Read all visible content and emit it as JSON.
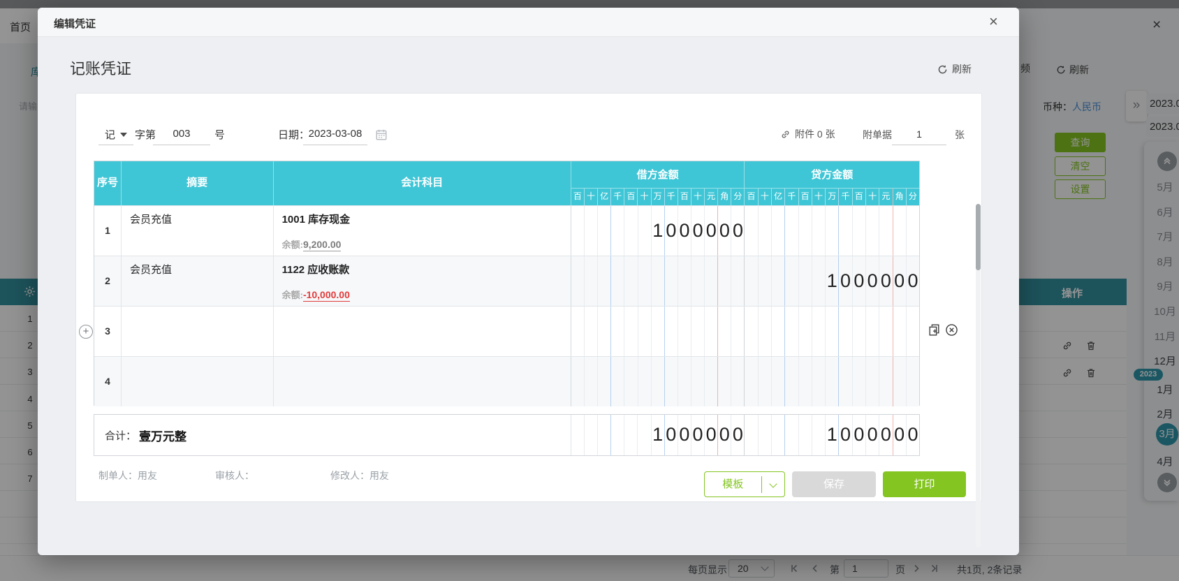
{
  "background": {
    "top_tab": "首页",
    "left_tab_fragment": "库",
    "left_placeholder_fragment": "请输",
    "right_tab_fragment": "频",
    "refresh_label": "刷新",
    "currency_label": "币种：",
    "currency_value": "人民币",
    "query_button": "查询",
    "clear_button": "清空",
    "settings_button": "设置",
    "action_header": "操作",
    "row_numbers": [
      "1",
      "2",
      "3",
      "4",
      "5",
      "6",
      "7"
    ],
    "period_items": [
      "2023.0",
      "2023.0"
    ],
    "expand_glyph": "»",
    "year_badge": "2023",
    "months": [
      {
        "label": "5月",
        "state": "past"
      },
      {
        "label": "6月",
        "state": "past"
      },
      {
        "label": "7月",
        "state": "past"
      },
      {
        "label": "8月",
        "state": "past"
      },
      {
        "label": "9月",
        "state": "past"
      },
      {
        "label": "10月",
        "state": "past"
      },
      {
        "label": "11月",
        "state": "past"
      },
      {
        "label": "12月",
        "state": "dark"
      },
      {
        "label": "1月",
        "state": "dark"
      },
      {
        "label": "2月",
        "state": "dark"
      },
      {
        "label": "3月",
        "state": "active"
      },
      {
        "label": "4月",
        "state": "dark"
      }
    ],
    "pagination": {
      "per_page_label": "每页显示",
      "per_page_value": "20",
      "page_prefix": "第",
      "page_value": "1",
      "page_suffix": "页",
      "summary": "共1页, 2条记录"
    },
    "close_glyph": "×"
  },
  "modal": {
    "title": "编辑凭证",
    "close_glyph": "×",
    "voucher": {
      "title": "记账凭证",
      "refresh_label": "刷新",
      "word_value": "记",
      "word_label": "字第",
      "number_value": "003",
      "number_suffix": "号",
      "date_label": "日期：",
      "date_value": "2023-03-08",
      "attachment_label": "附件 0 张",
      "docs_label": "附单据",
      "docs_value": "1",
      "docs_unit": "张",
      "table": {
        "seq_header": "序号",
        "summary_header": "摘要",
        "subject_header": "会计科目",
        "debit_header": "借方金额",
        "credit_header": "贷方金额",
        "digit_units": [
          "百",
          "十",
          "亿",
          "千",
          "百",
          "十",
          "万",
          "千",
          "百",
          "十",
          "元",
          "角",
          "分"
        ],
        "rows": [
          {
            "seq": "1",
            "summary": "会员充值",
            "subject": "1001 库存现金",
            "balance_label": "余额:",
            "balance_value": "9,200.00",
            "balance_tone": "normal",
            "debit_digits": [
              "",
              "",
              "",
              "",
              "",
              "",
              "1",
              "0",
              "0",
              "0",
              "0",
              "0",
              "0"
            ],
            "credit_digits": [
              "",
              "",
              "",
              "",
              "",
              "",
              "",
              "",
              "",
              "",
              "",
              "",
              ""
            ]
          },
          {
            "seq": "2",
            "summary": "会员充值",
            "subject": "1122 应收账款",
            "balance_label": "余额:",
            "balance_value": "-10,000.00",
            "balance_tone": "negative",
            "debit_digits": [
              "",
              "",
              "",
              "",
              "",
              "",
              "",
              "",
              "",
              "",
              "",
              "",
              ""
            ],
            "credit_digits": [
              "",
              "",
              "",
              "",
              "",
              "",
              "1",
              "0",
              "0",
              "0",
              "0",
              "0",
              "0"
            ]
          },
          {
            "seq": "3",
            "summary": "",
            "subject": "",
            "balance_label": "",
            "balance_value": "",
            "balance_tone": "normal",
            "debit_digits": [
              "",
              "",
              "",
              "",
              "",
              "",
              "",
              "",
              "",
              "",
              "",
              "",
              ""
            ],
            "credit_digits": [
              "",
              "",
              "",
              "",
              "",
              "",
              "",
              "",
              "",
              "",
              "",
              "",
              ""
            ]
          },
          {
            "seq": "4",
            "summary": "",
            "subject": "",
            "balance_label": "",
            "balance_value": "",
            "balance_tone": "normal",
            "debit_digits": [
              "",
              "",
              "",
              "",
              "",
              "",
              "",
              "",
              "",
              "",
              "",
              "",
              ""
            ],
            "credit_digits": [
              "",
              "",
              "",
              "",
              "",
              "",
              "",
              "",
              "",
              "",
              "",
              "",
              ""
            ]
          }
        ],
        "total_label": "合计：",
        "total_in_words": "壹万元整",
        "total_debit_digits": [
          "",
          "",
          "",
          "",
          "",
          "",
          "1",
          "0",
          "0",
          "0",
          "0",
          "0",
          "0"
        ],
        "total_credit_digits": [
          "",
          "",
          "",
          "",
          "",
          "",
          "1",
          "0",
          "0",
          "0",
          "0",
          "0",
          "0"
        ]
      },
      "makers": {
        "creator_label": "制单人：",
        "creator_value": "用友",
        "auditor_label": "审核人：",
        "auditor_value": "",
        "modifier_label": "修改人：",
        "modifier_value": "用友"
      },
      "actions": {
        "template": "模板",
        "save": "保存",
        "print": "打印"
      }
    }
  },
  "colors": {
    "header_cyan": "#3fc6d6",
    "accent_green": "#84c521",
    "accent_teal": "#2f96ab",
    "negative_red": "#e23b3b",
    "link_blue": "#4a90d9"
  }
}
